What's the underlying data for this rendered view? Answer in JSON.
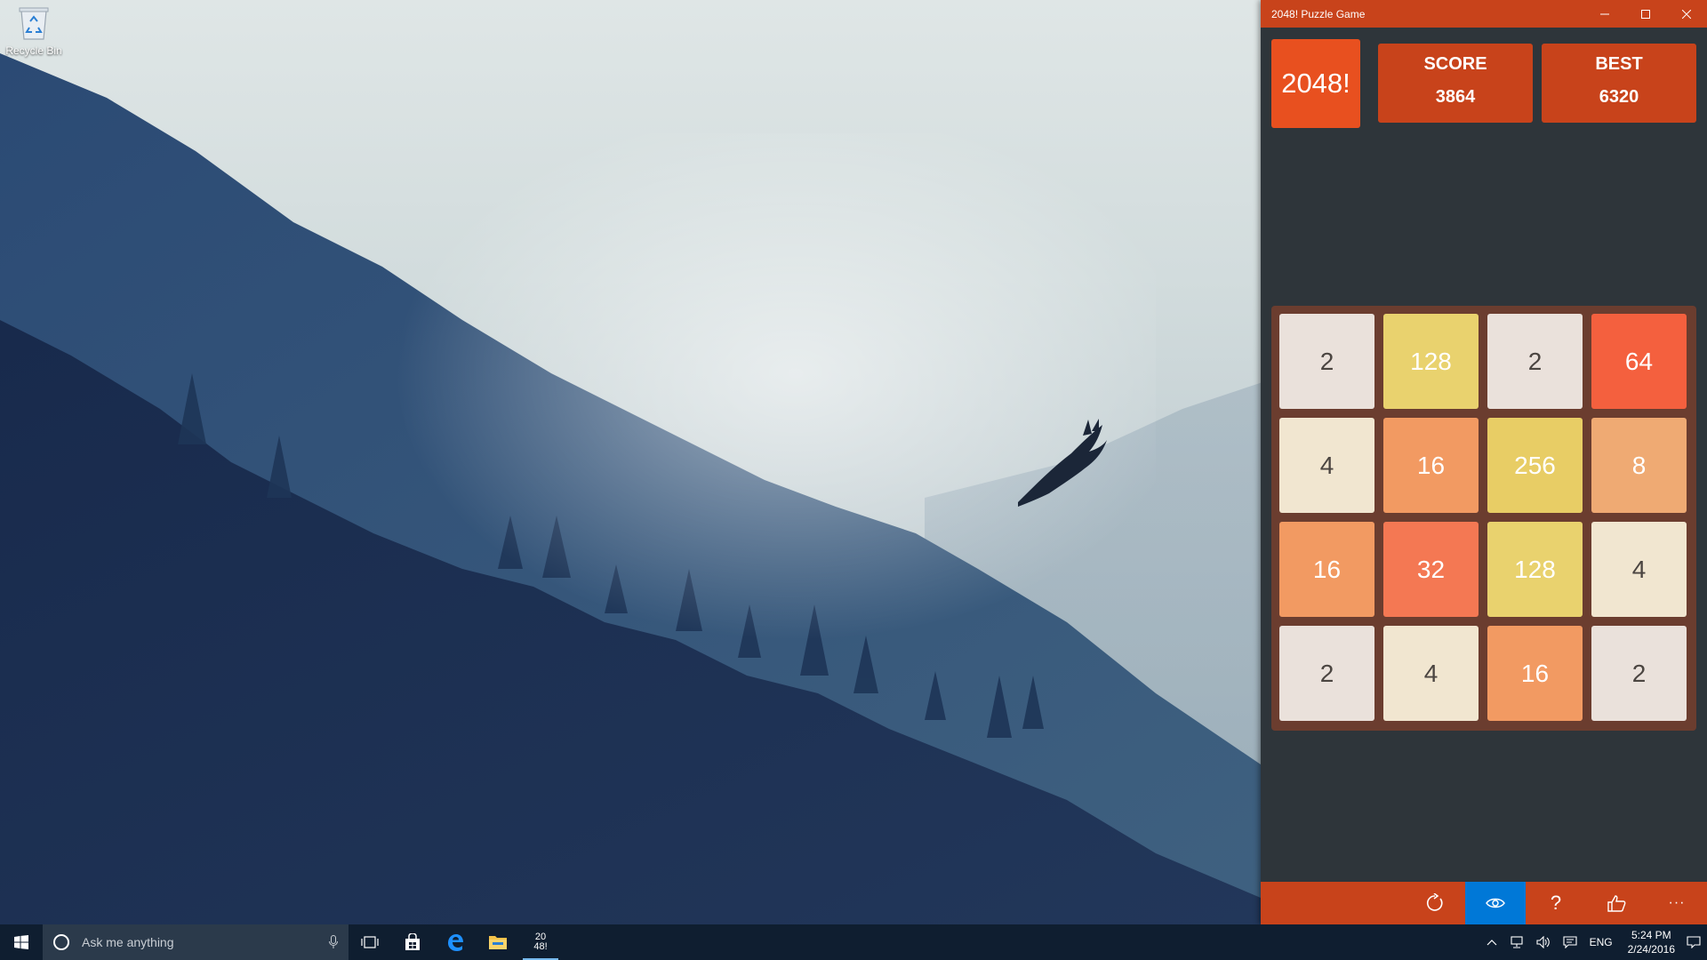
{
  "desktop": {
    "icons": [
      {
        "label": "Recycle Bin",
        "icon": "recycle-bin-icon"
      }
    ]
  },
  "window": {
    "title": "2048! Puzzle Game",
    "controls": {
      "minimize": "minimize-icon",
      "maximize": "maximize-icon",
      "close": "close-icon"
    },
    "logo": "2048!",
    "score": {
      "label": "SCORE",
      "value": "3864"
    },
    "best": {
      "label": "BEST",
      "value": "6320"
    },
    "board": [
      [
        "2",
        "128",
        "2",
        "64"
      ],
      [
        "4",
        "16",
        "256",
        "8"
      ],
      [
        "16",
        "32",
        "128",
        "4"
      ],
      [
        "2",
        "4",
        "16",
        "2"
      ]
    ],
    "appbar": [
      {
        "name": "restart-icon",
        "active": false
      },
      {
        "name": "eye-icon",
        "active": true
      },
      {
        "name": "help-icon",
        "glyph": "?",
        "active": false
      },
      {
        "name": "thumbs-up-icon",
        "active": false
      },
      {
        "name": "more-icon",
        "glyph": "···",
        "active": false
      }
    ]
  },
  "colors": {
    "accent": "#c8431b",
    "logo": "#e8501f",
    "board": "#6b3d2f",
    "app_background": "#2e353a",
    "active_button": "#0078d7",
    "tiles": {
      "2": "#eae1db",
      "4": "#f1e6d0",
      "8": "#efaa73",
      "16": "#f29a62",
      "32": "#f47853",
      "64": "#f4603e",
      "128": "#e9d26e",
      "256": "#e8cd65"
    }
  },
  "taskbar": {
    "search_placeholder": "Ask me anything",
    "pinned": [
      "task-view-icon",
      "store-icon",
      "edge-icon",
      "file-explorer-icon",
      "2048-app-icon"
    ],
    "app_icon_text": [
      "20",
      "48!"
    ],
    "language": "ENG",
    "time": "5:24 PM",
    "date": "2/24/2016"
  }
}
